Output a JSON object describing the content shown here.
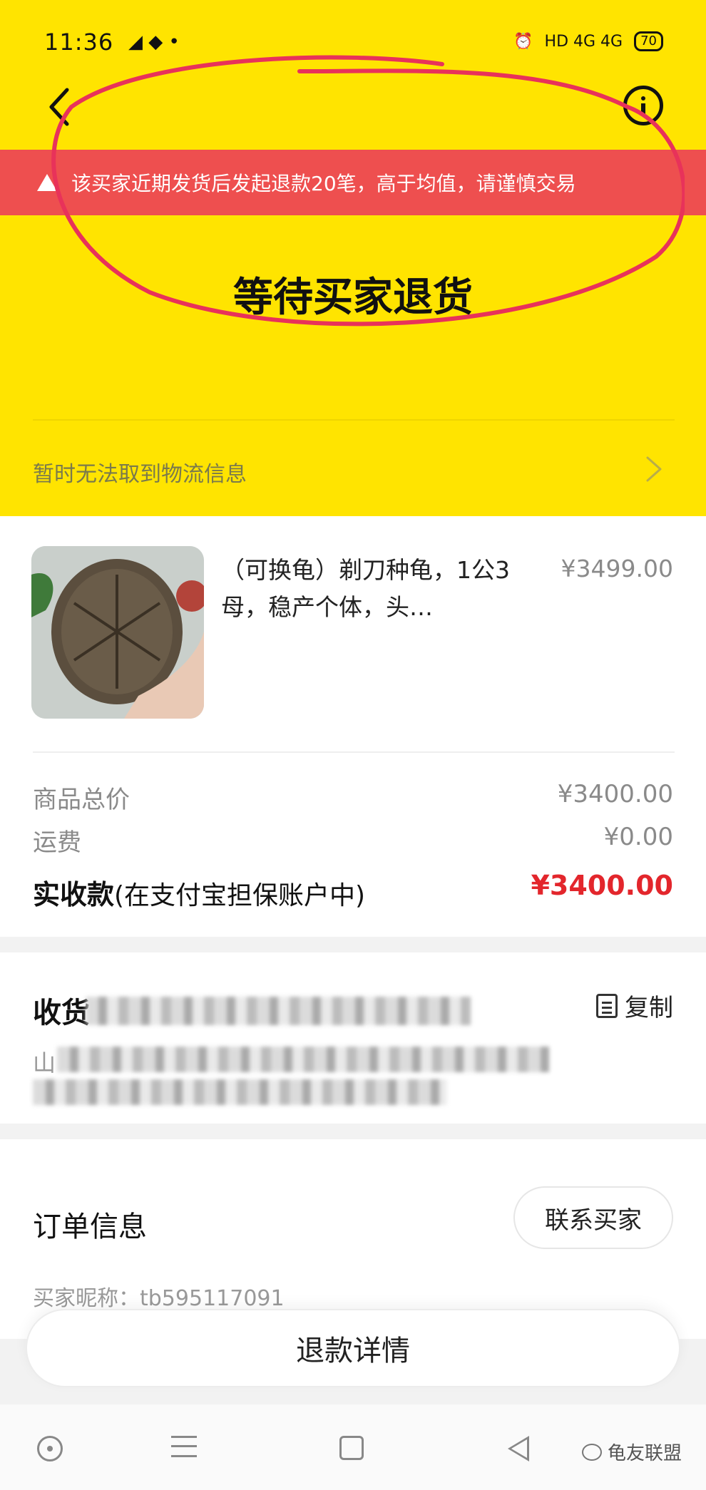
{
  "status_bar": {
    "time": "11:36",
    "indicators": "HD  4G  4G",
    "battery": "70"
  },
  "warning": {
    "text": "该买家近期发货后发起退款20笔，高于均值，请谨慎交易"
  },
  "order_status": {
    "title": "等待买家退货",
    "logistics": "暂时无法取到物流信息"
  },
  "product": {
    "title": "（可换龟）剃刀种龟，1公3母，稳产个体，头…",
    "price": "¥3499.00"
  },
  "summary": {
    "goods_total_label": "商品总价",
    "goods_total_value": "¥3400.00",
    "shipping_label": "运费",
    "shipping_value": "¥0.00",
    "received_label": "实收款",
    "received_note": "(在支付宝担保账户中)",
    "received_value": "¥3400.00"
  },
  "address": {
    "name_prefix": "收货",
    "address_prefix": "山",
    "copy_label": "复制"
  },
  "order_info": {
    "title": "订单信息",
    "contact_label": "联系买家",
    "buyer_nick": "买家昵称：tb595117091"
  },
  "actions": {
    "refund_details": "退款详情"
  },
  "watermark": {
    "text": "龟友联盟"
  },
  "colors": {
    "header_yellow": "#ffe400",
    "warning_red": "#ee4f4f",
    "price_red": "#e3262c"
  }
}
